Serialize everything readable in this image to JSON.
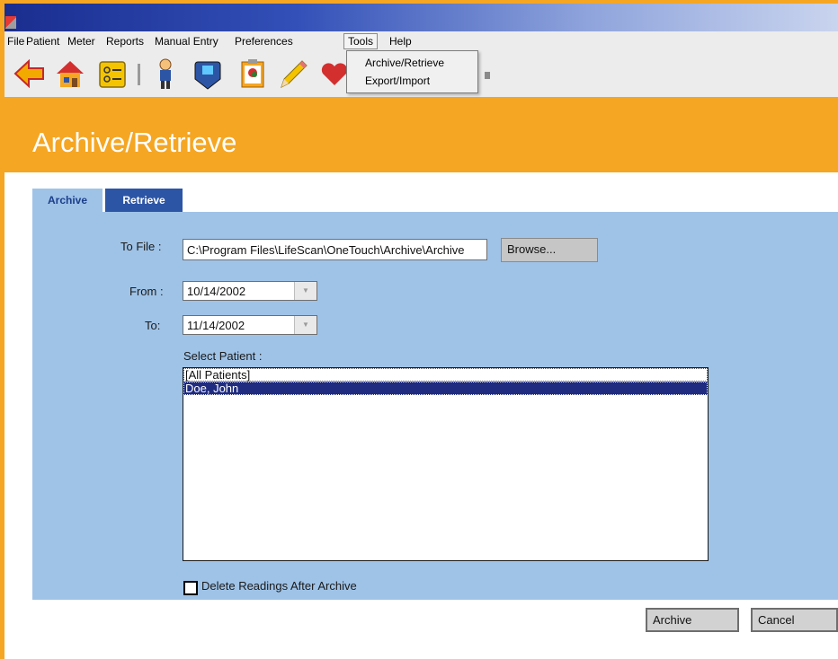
{
  "menu": {
    "items": [
      "File",
      "Patient",
      "Meter",
      "Reports",
      "Manual Entry",
      "Preferences",
      "Tools",
      "Help"
    ],
    "active": "Tools"
  },
  "tools_menu": {
    "items": [
      "Archive/Retrieve",
      "Export/Import"
    ]
  },
  "toolbar": {
    "icons": [
      "back-arrow-icon",
      "home-icon",
      "records-icon",
      "patient-icon",
      "meter-icon",
      "logbook-icon",
      "pencil-icon",
      "heart-icon"
    ]
  },
  "header": {
    "title": "Archive/Retrieve"
  },
  "tabs": {
    "archive": "Archive",
    "retrieve": "Retrieve"
  },
  "form": {
    "to_file_label": "To File :",
    "to_file_value": "C:\\Program Files\\LifeScan\\OneTouch\\Archive\\Archive",
    "browse_label": "Browse...",
    "from_label": "From :",
    "from_value": "10/14/2002",
    "to_label": "To:",
    "to_value": "11/14/2002",
    "select_patient_label": "Select Patient :",
    "patients": [
      "[All Patients]",
      "Doe, John"
    ],
    "selected_patient": "Doe, John",
    "delete_checkbox_label": "Delete Readings After Archive",
    "delete_checked": false
  },
  "buttons": {
    "archive": "Archive",
    "cancel": "Cancel"
  },
  "colors": {
    "brand_orange": "#f5a623",
    "panel_blue": "#9fc3e7",
    "tab_active_text": "#1b3f8b",
    "tab_inactive_bg": "#2c55a6",
    "selection": "#1f2c80"
  }
}
